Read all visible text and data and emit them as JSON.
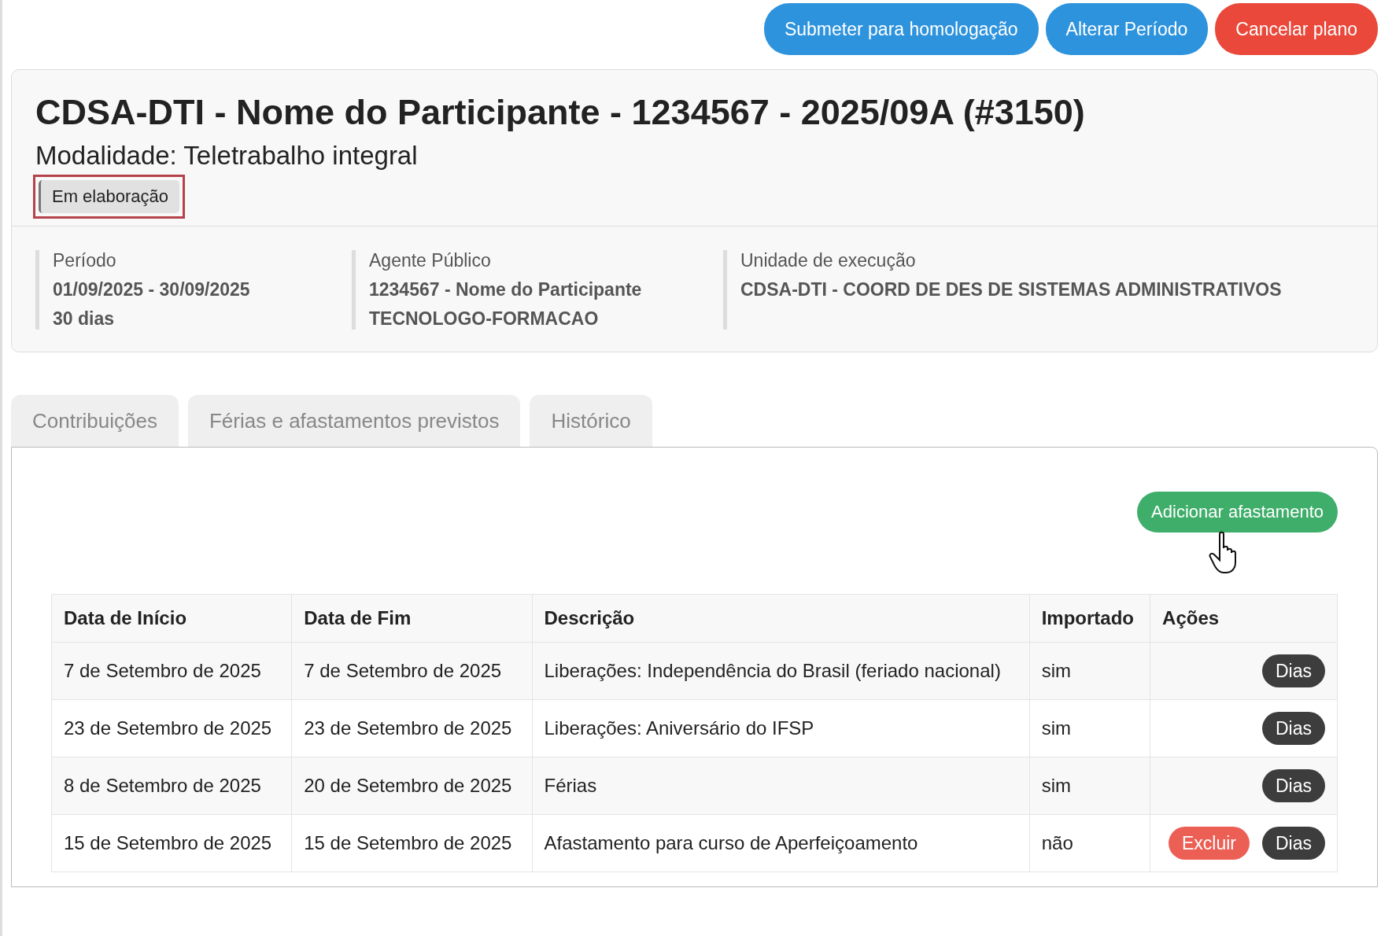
{
  "actions": [
    {
      "label": "Submeter para homologação",
      "kind": "primary"
    },
    {
      "label": "Alterar Período",
      "kind": "primary"
    },
    {
      "label": "Cancelar plano",
      "kind": "danger"
    }
  ],
  "plan": {
    "title": "CDSA-DTI - Nome do Participante - 1234567 - 2025/09A (#3150)",
    "modality": "Modalidade: Teletrabalho integral",
    "status": {
      "label": "Em elaboração",
      "highlighted": true
    },
    "info": [
      {
        "label": "Período",
        "lines": [
          "01/09/2025 - 30/09/2025",
          "30 dias"
        ]
      },
      {
        "label": "Agente Público",
        "lines": [
          "1234567 - Nome do Participante",
          "TECNOLOGO-FORMACAO"
        ]
      },
      {
        "label": "Unidade de execução",
        "lines": [
          "CDSA-DTI - COORD DE DES DE SISTEMAS ADMINISTRATIVOS"
        ]
      }
    ]
  },
  "tabs": [
    {
      "label": "Contribuições",
      "selected": false
    },
    {
      "label": "Férias e afastamentos previstos",
      "selected": false
    },
    {
      "label": "Histórico",
      "selected": false
    }
  ],
  "add_button": "Adicionar afastamento",
  "table": {
    "columns": [
      "Data de Início",
      "Data de Fim",
      "Descrição",
      "Importado",
      "Ações"
    ],
    "rows": [
      {
        "cells": [
          "7 de Setembro de 2025",
          "7 de Setembro de 2025",
          "Liberações: Independência do Brasil (feriado nacional)",
          "sim"
        ],
        "actions": [
          {
            "label": "Dias",
            "kind": "dark"
          }
        ]
      },
      {
        "cells": [
          "23 de Setembro de 2025",
          "23 de Setembro de 2025",
          "Liberações: Aniversário do IFSP",
          "sim"
        ],
        "actions": [
          {
            "label": "Dias",
            "kind": "dark"
          }
        ]
      },
      {
        "cells": [
          "8 de Setembro de 2025",
          "20 de Setembro de 2025",
          "Férias",
          "sim"
        ],
        "actions": [
          {
            "label": "Dias",
            "kind": "dark"
          }
        ]
      },
      {
        "cells": [
          "15 de Setembro de 2025",
          "15 de Setembro de 2025",
          "Afastamento para curso de Aperfeiçoamento",
          "não"
        ],
        "actions": [
          {
            "label": "Excluir",
            "kind": "danger"
          },
          {
            "label": "Dias",
            "kind": "dark"
          }
        ]
      }
    ]
  }
}
